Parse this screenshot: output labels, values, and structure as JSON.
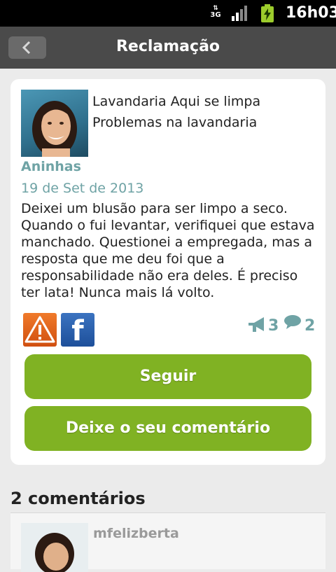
{
  "status_bar": {
    "network": "3G",
    "time": "16h03"
  },
  "header": {
    "title": "Reclamação",
    "back_icon": "chevron-left-icon"
  },
  "complaint": {
    "company": "Lavandaria Aqui se limpa",
    "category": "Problemas na lavandaria",
    "author": "Aninhas",
    "date": "19 de Set de 2013",
    "text": "Deixei um blusão para ser limpo a seco. Quando o fui levantar, verifiquei que estava manchado. Questionei a empregada, mas a resposta que me deu foi que a responsabilidade não era deles. É preciso ter lata! Nunca mais lá volto.",
    "followers": "3",
    "comments_count": "2",
    "facebook_glyph": "f"
  },
  "actions": {
    "follow_label": "Seguir",
    "comment_label": "Deixe o seu comentário"
  },
  "comments": {
    "title": "2 comentários",
    "items": [
      {
        "user": "mfelizberta"
      }
    ]
  },
  "colors": {
    "accent_green": "#80b223",
    "teal_text": "#6fa3a5",
    "header_bg": "#4a4a4a"
  }
}
